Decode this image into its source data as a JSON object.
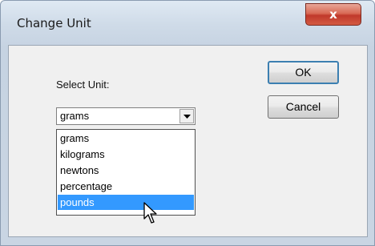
{
  "window": {
    "title": "Change Unit",
    "close_glyph": "x"
  },
  "form": {
    "select_label": "Select Unit:",
    "selected_value": "grams",
    "options": [
      "grams",
      "kilograms",
      "newtons",
      "percentage",
      "pounds"
    ],
    "highlighted_option": "pounds"
  },
  "buttons": {
    "ok_label": "OK",
    "cancel_label": "Cancel"
  },
  "colors": {
    "highlight": "#3399ff",
    "close_button": "#c0392b"
  },
  "icons": {
    "dropdown": "chevron-down-icon",
    "close": "close-icon",
    "cursor": "mouse-pointer-icon"
  }
}
